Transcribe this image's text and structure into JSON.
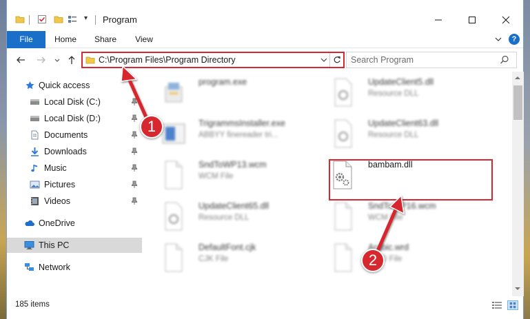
{
  "window": {
    "title": "Program",
    "controls": {
      "minimize": "minimize",
      "maximize": "maximize",
      "close": "close"
    }
  },
  "ribbon": {
    "tabs": [
      "File",
      "Home",
      "Share",
      "View"
    ],
    "help": "?"
  },
  "address": {
    "path": "C:\\Program Files\\Program Directory"
  },
  "search": {
    "placeholder": "Search Program"
  },
  "sidebar": {
    "items": [
      {
        "label": "Quick access",
        "icon": "star-icon",
        "pinned": false
      },
      {
        "label": "Local Disk (C:)",
        "icon": "drive-icon",
        "pinned": true
      },
      {
        "label": "Local Disk (D:)",
        "icon": "drive-icon",
        "pinned": true
      },
      {
        "label": "Documents",
        "icon": "documents-icon",
        "pinned": true
      },
      {
        "label": "Downloads",
        "icon": "downloads-icon",
        "pinned": true
      },
      {
        "label": "Music",
        "icon": "music-icon",
        "pinned": true
      },
      {
        "label": "Pictures",
        "icon": "pictures-icon",
        "pinned": true
      },
      {
        "label": "Videos",
        "icon": "videos-icon",
        "pinned": true
      },
      {
        "label": "OneDrive",
        "icon": "onedrive-icon",
        "pinned": false
      },
      {
        "label": "This PC",
        "icon": "pc-icon",
        "pinned": false,
        "selected": true
      },
      {
        "label": "Network",
        "icon": "network-icon",
        "pinned": false
      }
    ]
  },
  "files": [
    {
      "name": "program.exe",
      "type": "",
      "icon": "exe-icon",
      "blurred": true
    },
    {
      "name": "UpdateClient5.dll",
      "type": "Resource DLL",
      "icon": "dll-icon",
      "blurred": true
    },
    {
      "name": "TrigrammsInstaller.exe",
      "type": "ABBYY finereader tri...",
      "icon": "installer-icon",
      "blurred": true
    },
    {
      "name": "UpdateClient63.dll",
      "type": "Resource DLL",
      "icon": "dll-icon",
      "blurred": true
    },
    {
      "name": "SndToWP13.wcm",
      "type": "WCM File",
      "icon": "file-icon",
      "blurred": true
    },
    {
      "name": "bambam.dll",
      "type": "",
      "icon": "dll-gear-icon",
      "blurred": false
    },
    {
      "name": "UpdateClient65.dll",
      "type": "Resource DLL",
      "icon": "dll-icon",
      "blurred": true
    },
    {
      "name": "SndToWP16.wcm",
      "type": "WCM File",
      "icon": "file-icon",
      "blurred": true
    },
    {
      "name": "DefaultFont.cjk",
      "type": "CJK File",
      "icon": "file-icon",
      "blurred": true
    },
    {
      "name": "Arabic.wrd",
      "type": "WRD File",
      "icon": "file-icon",
      "blurred": true
    }
  ],
  "status": {
    "item_count": "185 items"
  },
  "annotations": {
    "badge1": "1",
    "badge2": "2",
    "color": "#d7282f"
  },
  "colors": {
    "accent": "#1a6fc9",
    "highlight_red": "#d7282f",
    "selected_bg": "#d9d9d9"
  }
}
